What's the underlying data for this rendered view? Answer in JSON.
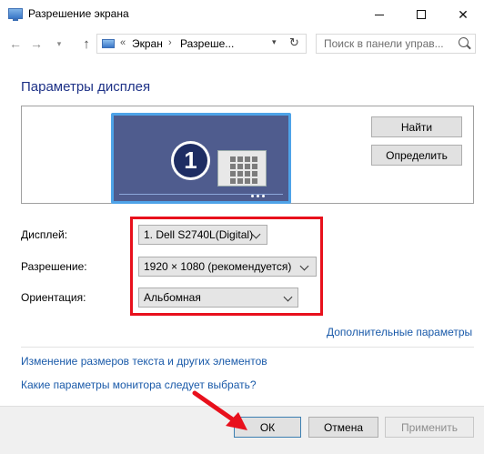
{
  "window": {
    "title": "Разрешение экрана",
    "minimize_glyph": "",
    "close_glyph": "✕"
  },
  "address_bar": {
    "overflow": "«",
    "crumbs": [
      "Экран",
      "Разреше..."
    ],
    "separator": "›",
    "search_placeholder": "Поиск в панели управ..."
  },
  "main": {
    "heading": "Параметры дисплея",
    "monitor_number": "1",
    "buttons": {
      "find": "Найти",
      "identify": "Определить"
    },
    "fields": {
      "display_label": "Дисплей:",
      "display_value": "1. Dell S2740L(Digital)",
      "resolution_label": "Разрешение:",
      "resolution_value": "1920 × 1080 (рекомендуется)",
      "orientation_label": "Ориентация:",
      "orientation_value": "Альбомная"
    },
    "advanced_link": "Дополнительные параметры",
    "links": [
      "Изменение размеров текста и других элементов",
      "Какие параметры монитора следует выбрать?"
    ]
  },
  "footer": {
    "ok": "ОК",
    "cancel": "Отмена",
    "apply": "Применить"
  },
  "colors": {
    "heading": "#1e3287",
    "link": "#1a5aa9",
    "highlight": "#e8101c",
    "monitor_bezel": "#4ea3e8"
  }
}
